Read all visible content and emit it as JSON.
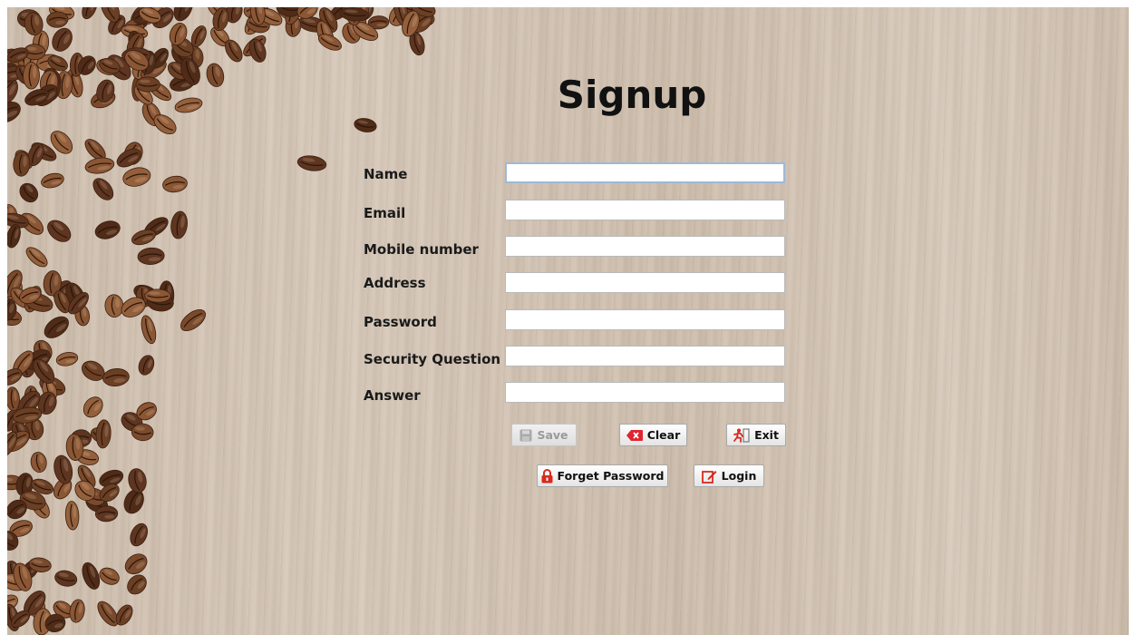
{
  "form": {
    "title": "Signup",
    "fields": [
      {
        "label": "Name",
        "value": ""
      },
      {
        "label": "Email",
        "value": ""
      },
      {
        "label": "Mobile number",
        "value": ""
      },
      {
        "label": "Address",
        "value": ""
      },
      {
        "label": "Password",
        "value": ""
      },
      {
        "label": "Security Question",
        "value": ""
      },
      {
        "label": "Answer",
        "value": ""
      }
    ]
  },
  "buttons": {
    "save": "Save",
    "clear": "Clear",
    "exit": "Exit",
    "forget_password": "Forget Password",
    "login": "Login"
  },
  "icons": {
    "save": "floppy-disk-icon",
    "clear": "clear-eraser-icon",
    "exit": "exit-door-icon",
    "forget_password": "padlock-icon",
    "login": "edit-pencil-icon"
  },
  "colors": {
    "wood_background": "#d6c7b7",
    "bean": "#6b3f24",
    "clear_icon": "#e0242f",
    "lock_icon": "#d82a1e"
  }
}
